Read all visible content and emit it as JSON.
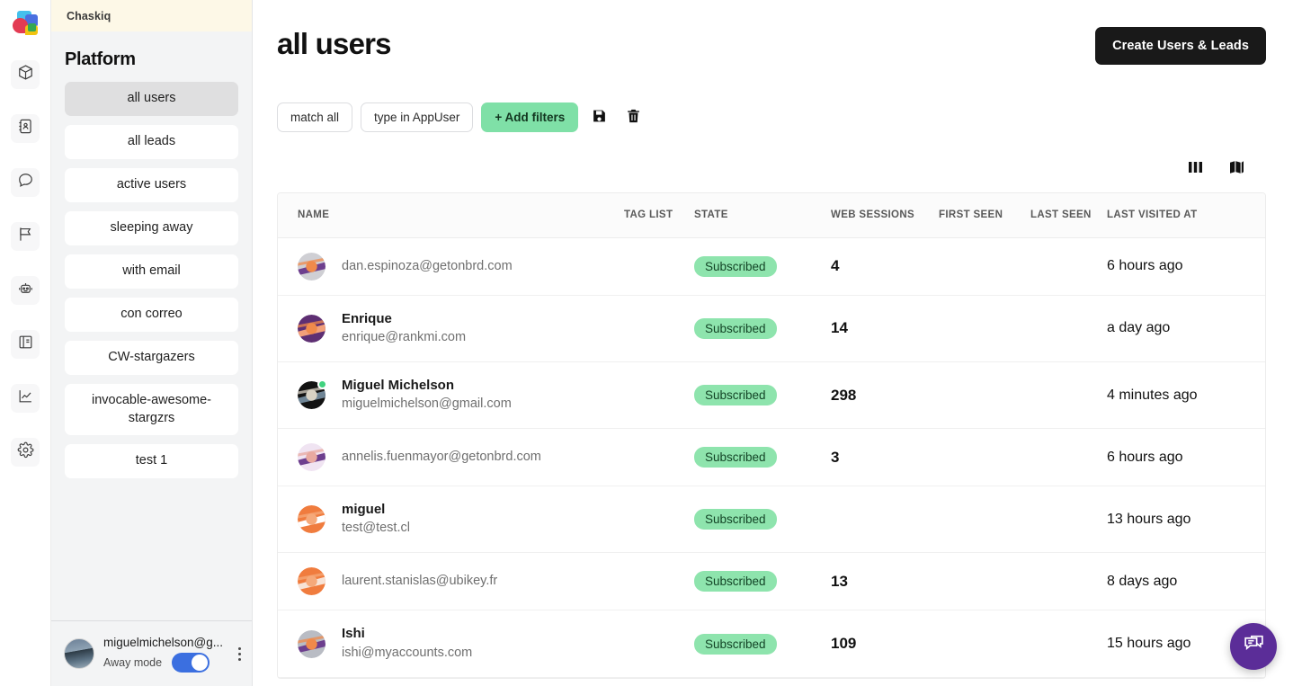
{
  "brand": {
    "name": "Chaskiq",
    "logo_icon": "chaskiq-bubbles-logo"
  },
  "rail": {
    "items": [
      {
        "icon": "cube-icon",
        "name": "platform"
      },
      {
        "icon": "contact-book-icon",
        "name": "contacts"
      },
      {
        "icon": "chat-bubble-icon",
        "name": "conversations"
      },
      {
        "icon": "flag-icon",
        "name": "campaigns"
      },
      {
        "icon": "robot-icon",
        "name": "bots"
      },
      {
        "icon": "book-icon",
        "name": "articles"
      },
      {
        "icon": "chart-line-icon",
        "name": "reports"
      },
      {
        "icon": "gear-icon",
        "name": "settings"
      }
    ]
  },
  "sidebar": {
    "header": "Chaskiq",
    "title": "Platform",
    "items": [
      {
        "label": "all users",
        "active": true
      },
      {
        "label": "all leads",
        "active": false
      },
      {
        "label": "active users",
        "active": false
      },
      {
        "label": "sleeping away",
        "active": false
      },
      {
        "label": "with email",
        "active": false
      },
      {
        "label": "con correo",
        "active": false
      },
      {
        "label": "CW-stargazers",
        "active": false
      },
      {
        "label": "invocable-awesome-stargzrs",
        "active": false
      },
      {
        "label": "test 1",
        "active": false
      }
    ],
    "user": {
      "email": "miguelmichelson@g...",
      "away_label": "Away mode",
      "away_on": true,
      "menu_icon": "vertical-dots-icon"
    }
  },
  "header": {
    "title": "all users",
    "create_button": "Create Users & Leads"
  },
  "filters": {
    "match": "match all",
    "type": "type in AppUser",
    "add": "+ Add filters",
    "save_icon": "save-floppy-icon",
    "delete_icon": "trash-icon"
  },
  "view_toggles": [
    {
      "icon": "columns-view-icon",
      "name": "columns-view"
    },
    {
      "icon": "map-view-icon",
      "name": "map-view"
    }
  ],
  "table": {
    "columns": [
      "NAME",
      "TAG LIST",
      "STATE",
      "WEB SESSIONS",
      "FIRST SEEN",
      "LAST SEEN",
      "LAST VISITED AT"
    ],
    "rows": [
      {
        "name": "",
        "email": "dan.espinoza@getonbrd.com",
        "tag_list": "",
        "state": "Subscribed",
        "web_sessions": "4",
        "first_seen": "",
        "last_seen": "",
        "last_visited_at": "6 hours ago",
        "online": false,
        "avatar_colors": [
          "#cfcfd4",
          "#6d3f8e",
          "#f08a4b"
        ]
      },
      {
        "name": "Enrique",
        "email": "enrique@rankmi.com",
        "tag_list": "",
        "state": "Subscribed",
        "web_sessions": "14",
        "first_seen": "",
        "last_seen": "",
        "last_visited_at": "a day ago",
        "online": false,
        "avatar_colors": [
          "#5e2f73",
          "#f2a07a",
          "#f08a4b"
        ]
      },
      {
        "name": "Miguel Michelson",
        "email": "miguelmichelson@gmail.com",
        "tag_list": "",
        "state": "Subscribed",
        "web_sessions": "298",
        "first_seen": "",
        "last_seen": "",
        "last_visited_at": "4 minutes ago",
        "online": true,
        "avatar_colors": [
          "#121212",
          "#6f8596",
          "#d8d2c4"
        ]
      },
      {
        "name": "",
        "email": "annelis.fuenmayor@getonbrd.com",
        "tag_list": "",
        "state": "Subscribed",
        "web_sessions": "3",
        "first_seen": "",
        "last_seen": "",
        "last_visited_at": "6 hours ago",
        "online": false,
        "avatar_colors": [
          "#f0e4f2",
          "#6d3f8e",
          "#e8a9a0"
        ]
      },
      {
        "name": "miguel",
        "email": "test@test.cl",
        "tag_list": "",
        "state": "Subscribed",
        "web_sessions": "",
        "first_seen": "",
        "last_seen": "",
        "last_visited_at": "13 hours ago",
        "online": false,
        "avatar_colors": [
          "#f07c3e",
          "#ffffff",
          "#f5a97a"
        ]
      },
      {
        "name": "",
        "email": "laurent.stanislas@ubikey.fr",
        "tag_list": "",
        "state": "Subscribed",
        "web_sessions": "13",
        "first_seen": "",
        "last_seen": "",
        "last_visited_at": "8 days ago",
        "online": false,
        "avatar_colors": [
          "#f07c3e",
          "#f7e3d6",
          "#f5a97a"
        ]
      },
      {
        "name": "Ishi",
        "email": "ishi@myaccounts.com",
        "tag_list": "",
        "state": "Subscribed",
        "web_sessions": "109",
        "first_seen": "",
        "last_seen": "",
        "last_visited_at": "15 hours ago",
        "online": false,
        "avatar_colors": [
          "#b9bcc4",
          "#6d3f8e",
          "#f08a4b"
        ]
      }
    ]
  },
  "chat_widget": {
    "icon": "chat-bubbles-icon",
    "color": "#5b2d98"
  },
  "colors": {
    "accent_green": "#7fe0a7",
    "badge_green": "#8ee4ad",
    "dark_button": "#191919",
    "toggle_blue": "#3b6fe0",
    "sidebar_bg": "#f3f4f5",
    "header_cream": "#fdf8e7"
  }
}
